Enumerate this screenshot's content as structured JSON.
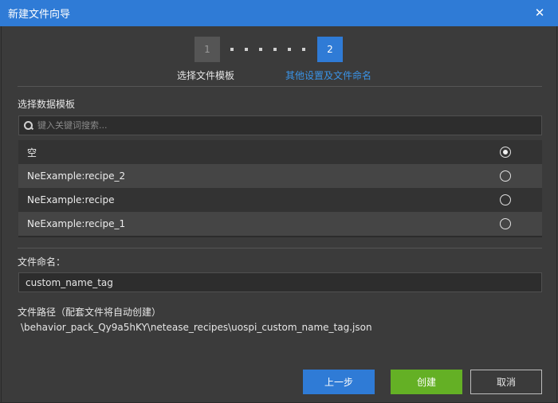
{
  "window": {
    "title": "新建文件向导",
    "close_glyph": "✕"
  },
  "stepper": {
    "step1_number": "1",
    "step2_number": "2",
    "step1_label": "选择文件模板",
    "step2_label": "其他设置及文件命名",
    "active_step": 2,
    "active_color": "#2f7bd6"
  },
  "template": {
    "section_label": "选择数据模板",
    "search_placeholder": "键入关键词搜索...",
    "items": [
      {
        "label": "空",
        "selected": true
      },
      {
        "label": "NeExample:recipe_2",
        "selected": false
      },
      {
        "label": "NeExample:recipe",
        "selected": false
      },
      {
        "label": "NeExample:recipe_1",
        "selected": false
      }
    ]
  },
  "naming": {
    "section_label": "文件命名：",
    "value": "custom_name_tag"
  },
  "path": {
    "section_label": "文件路径（配套文件将自动创建）",
    "value": "\\behavior_pack_Qy9a5hKY\\netease_recipes\\uospi_custom_name_tag.json"
  },
  "buttons": {
    "prev_label": "上一步",
    "create_label": "创建",
    "cancel_label": "取消",
    "create_color": "#64b025"
  }
}
